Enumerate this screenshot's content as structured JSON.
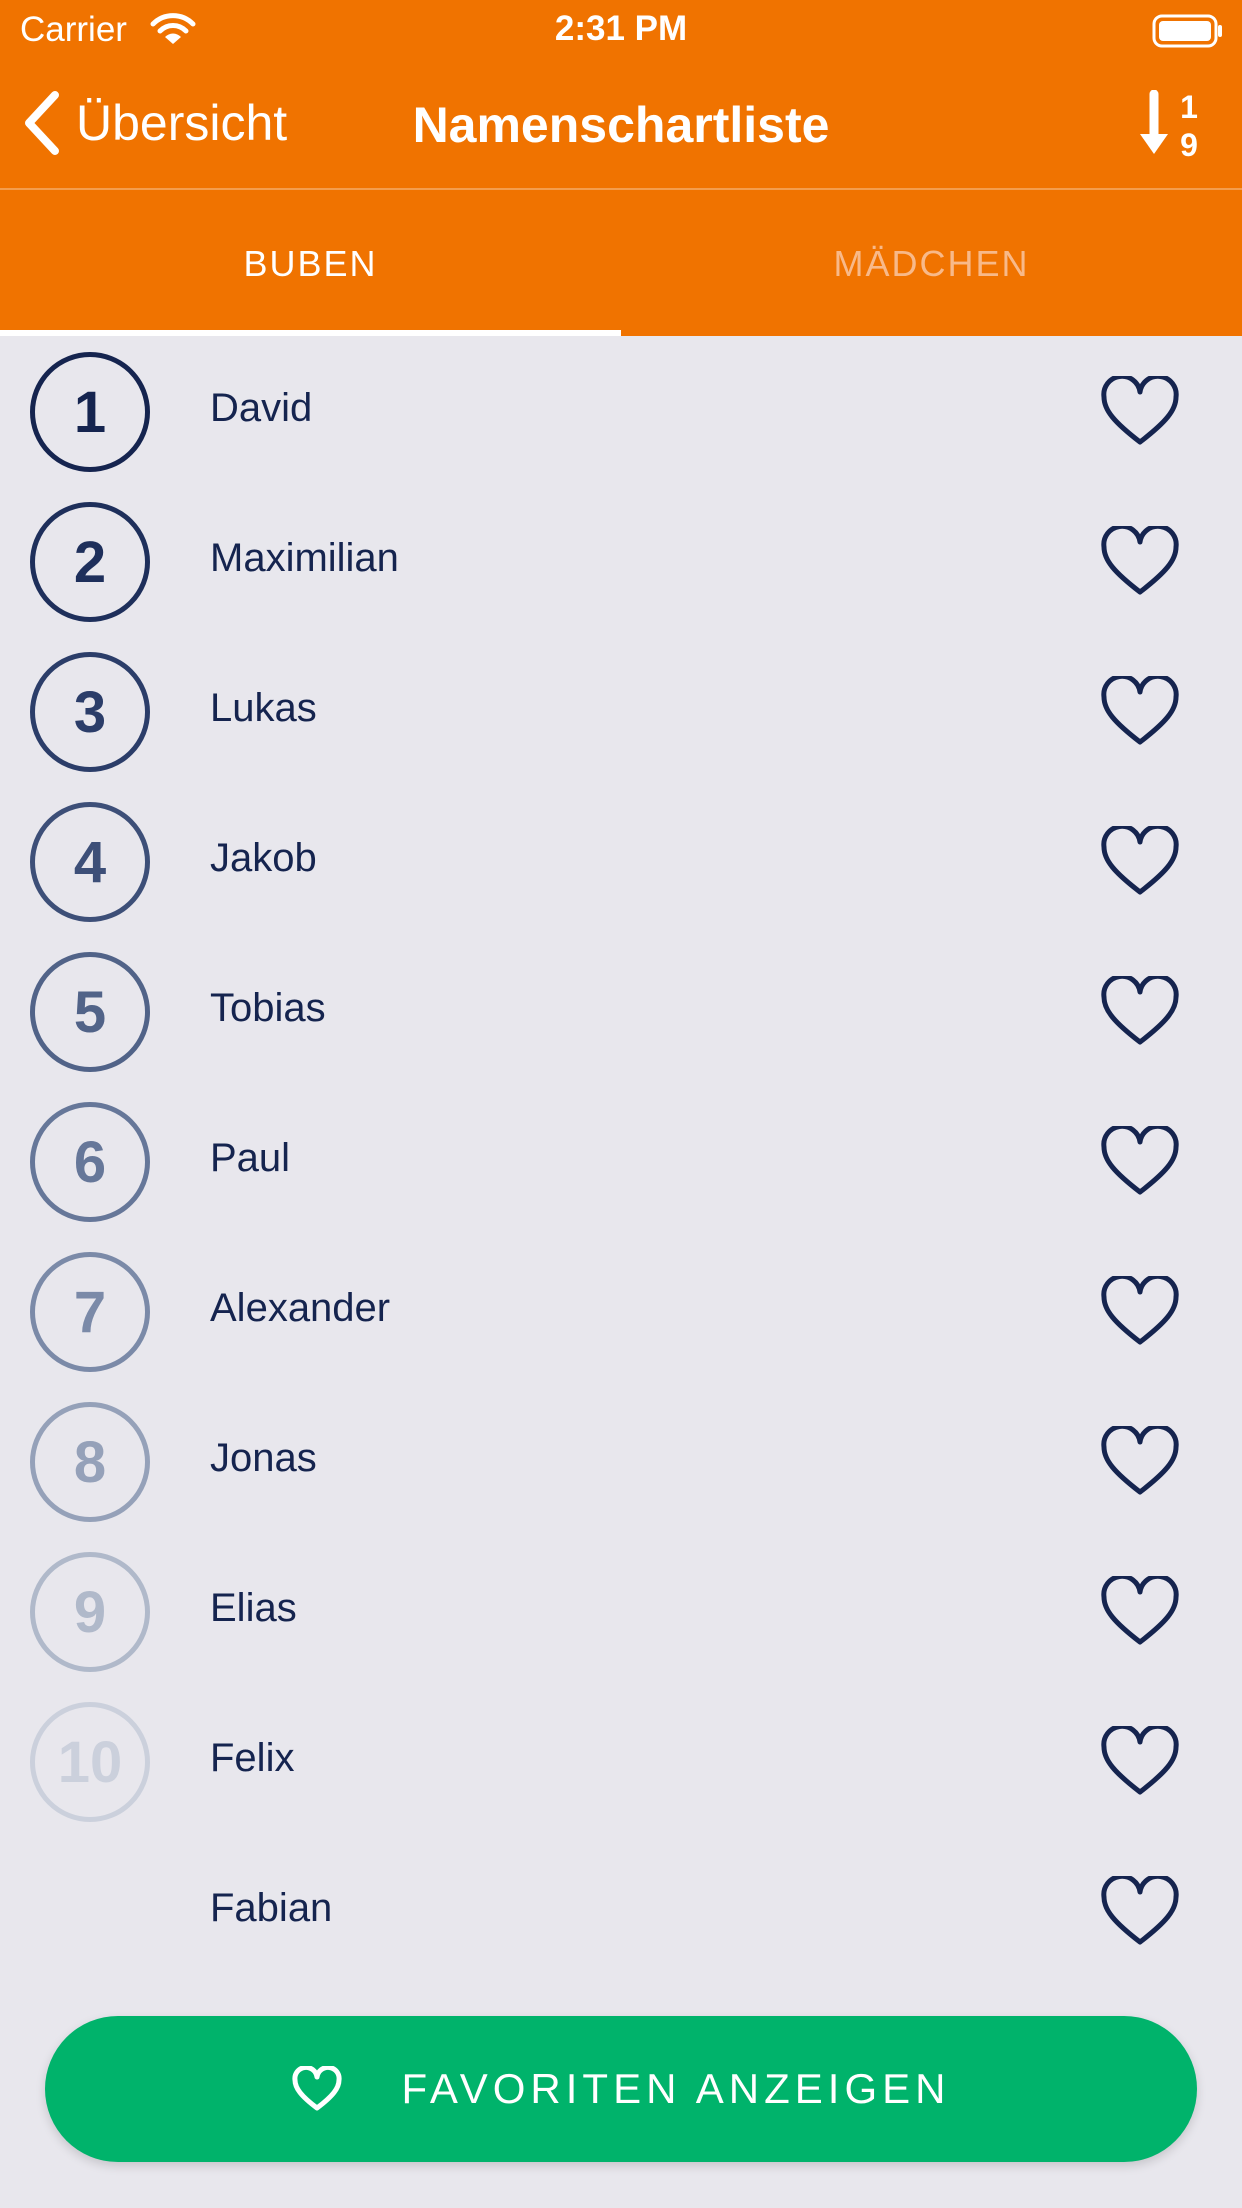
{
  "status_bar": {
    "carrier": "Carrier",
    "time": "2:31 PM"
  },
  "nav": {
    "back_label": "Übersicht",
    "title": "Namenschartliste",
    "sort_icon": "sort-ascending-numeric-icon"
  },
  "tabs": [
    {
      "label": "BUBEN",
      "active": true
    },
    {
      "label": "MÄDCHEN",
      "active": false
    }
  ],
  "names": [
    {
      "rank": "1",
      "name": "David"
    },
    {
      "rank": "2",
      "name": "Maximilian"
    },
    {
      "rank": "3",
      "name": "Lukas"
    },
    {
      "rank": "4",
      "name": "Jakob"
    },
    {
      "rank": "5",
      "name": "Tobias"
    },
    {
      "rank": "6",
      "name": "Paul"
    },
    {
      "rank": "7",
      "name": "Alexander"
    },
    {
      "rank": "8",
      "name": "Jonas"
    },
    {
      "rank": "9",
      "name": "Elias"
    },
    {
      "rank": "10",
      "name": "Felix"
    },
    {
      "rank": "",
      "name": "Fabian"
    }
  ],
  "bottom_button": {
    "label": "FAVORITEN ANZEIGEN",
    "icon": "heart-outline-icon"
  },
  "colors": {
    "header": "#F07300",
    "background": "#E8E7ED",
    "text_navy": "#15244F",
    "button_green": "#00B36B",
    "rank_colors": [
      "#15244F",
      "#1E2F5B",
      "#2B3D69",
      "#3D4F78",
      "#516388",
      "#667799",
      "#7B8AA8",
      "#95A1B9",
      "#B0B9CA",
      "#CBD0DC"
    ]
  }
}
